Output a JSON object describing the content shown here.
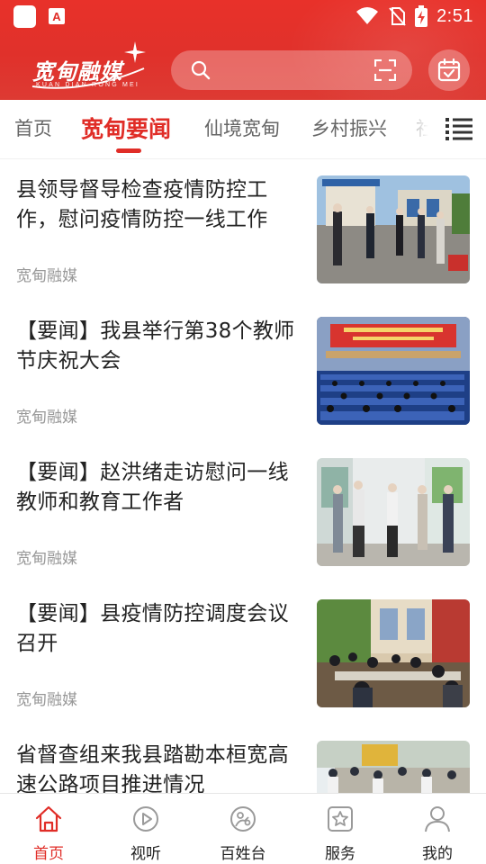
{
  "status_bar": {
    "time": "2:51"
  },
  "header": {
    "logo_text": "宽甸融媒",
    "logo_subtext": "KUAN DIAN RONG MEI",
    "search_placeholder": ""
  },
  "tabs": [
    {
      "label": "首页",
      "active": false
    },
    {
      "label": "宽甸要闻",
      "active": true
    },
    {
      "label": "仙境宽甸",
      "active": false
    },
    {
      "label": "乡村振兴",
      "active": false
    },
    {
      "label": "社",
      "active": false
    }
  ],
  "news": [
    {
      "title": "县领导督导检查疫情防控工作，慰问疫情防控一线工作",
      "source": "宽甸融媒"
    },
    {
      "title": "【要闻】我县举行第38个教师节庆祝大会",
      "source": "宽甸融媒"
    },
    {
      "title": "【要闻】赵洪绪走访慰问一线教师和教育工作者",
      "source": "宽甸融媒"
    },
    {
      "title": "【要闻】县疫情防控调度会议召开",
      "source": "宽甸融媒"
    },
    {
      "title": "省督查组来我县踏勘本桓宽高速公路项目推进情况",
      "source": ""
    }
  ],
  "bottom_nav": [
    {
      "label": "首页",
      "icon": "home-icon",
      "active": true
    },
    {
      "label": "视听",
      "icon": "play-icon",
      "active": false
    },
    {
      "label": "百姓台",
      "icon": "people-icon",
      "active": false
    },
    {
      "label": "服务",
      "icon": "service-star-icon",
      "active": false
    },
    {
      "label": "我的",
      "icon": "user-icon",
      "active": false
    }
  ],
  "colors": {
    "brand_red": "#e02d27",
    "header_red": "#e8312a",
    "text_dark": "#222222",
    "text_muted": "#999999"
  }
}
